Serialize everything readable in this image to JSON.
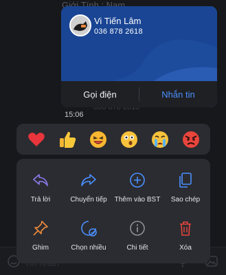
{
  "background": {
    "top_text": "Giới Tính : Nam",
    "timestamp": "15:06",
    "ghost_phone": "036 878 2618",
    "bottom_ghost": "Tin nhắn"
  },
  "contact_card": {
    "name": "Vi Tiến Lâm",
    "phone": "036 878 2618",
    "call_label": "Gọi điện",
    "message_label": "Nhắn tin",
    "accent": "#1e4c9d"
  },
  "reactions": [
    {
      "icon": "heart-icon"
    },
    {
      "icon": "thumbs-up-icon"
    },
    {
      "icon": "laughing-face-icon"
    },
    {
      "icon": "surprised-face-icon"
    },
    {
      "icon": "crying-face-icon"
    },
    {
      "icon": "angry-face-icon"
    }
  ],
  "actions": [
    {
      "label": "Trả lời",
      "icon": "reply-icon",
      "color": "#8b7bf0"
    },
    {
      "label": "Chuyển tiếp",
      "icon": "forward-icon",
      "color": "#4a90ff"
    },
    {
      "label": "Thêm vào BST",
      "icon": "add-to-collection-icon",
      "color": "#4a90ff"
    },
    {
      "label": "Sao chép",
      "icon": "copy-icon",
      "color": "#4a90ff"
    },
    {
      "label": "Ghim",
      "icon": "pin-icon",
      "color": "#f08a3c"
    },
    {
      "label": "Chọn nhiều",
      "icon": "multi-select-icon",
      "color": "#4a90ff"
    },
    {
      "label": "Chi tiết",
      "icon": "info-icon",
      "color": "#8e9096"
    },
    {
      "label": "Xóa",
      "icon": "trash-icon",
      "color": "#e8453c"
    }
  ]
}
